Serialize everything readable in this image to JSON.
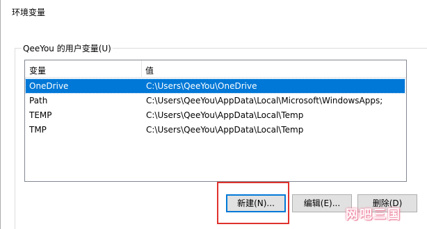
{
  "window": {
    "title": "环境变量"
  },
  "user_vars": {
    "group_label": "QeeYou 的用户变量(U)",
    "columns": {
      "name": "变量",
      "value": "值"
    },
    "rows": [
      {
        "name": "OneDrive",
        "value": "C:\\Users\\QeeYou\\OneDrive",
        "selected": true
      },
      {
        "name": "Path",
        "value": "C:\\Users\\QeeYou\\AppData\\Local\\Microsoft\\WindowsApps;",
        "selected": false
      },
      {
        "name": "TEMP",
        "value": "C:\\Users\\QeeYou\\AppData\\Local\\Temp",
        "selected": false
      },
      {
        "name": "TMP",
        "value": "C:\\Users\\QeeYou\\AppData\\Local\\Temp",
        "selected": false
      }
    ],
    "buttons": {
      "new_label": "新建(N)...",
      "edit_label": "编辑(E)...",
      "delete_label": "删除(D)"
    }
  },
  "watermark": {
    "text": "网吧三国"
  },
  "colors": {
    "selection": "#0078d7",
    "highlight_box": "#e0322d"
  }
}
